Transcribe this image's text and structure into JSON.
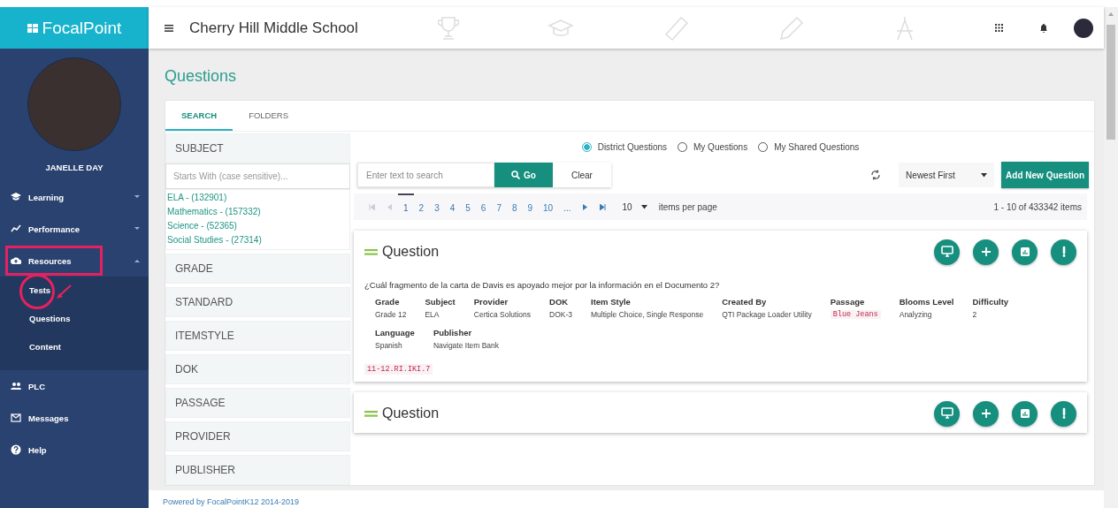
{
  "sidebar": {
    "brand": "FocalPoint",
    "user_name": "JANELLE DAY",
    "items": [
      {
        "label": "Learning",
        "expanded": false,
        "has_caret": true,
        "highlighted": false
      },
      {
        "label": "Performance",
        "expanded": false,
        "has_caret": true,
        "highlighted": false
      },
      {
        "label": "Resources",
        "expanded": true,
        "has_caret": true,
        "highlighted": true,
        "children": [
          {
            "label": "Tests",
            "highlighted": true
          },
          {
            "label": "Questions",
            "highlighted": false
          },
          {
            "label": "Content",
            "highlighted": false
          }
        ]
      },
      {
        "label": "PLC",
        "has_caret": false,
        "highlighted": false
      },
      {
        "label": "Messages",
        "has_caret": false,
        "highlighted": false
      },
      {
        "label": "Help",
        "has_caret": false,
        "highlighted": false
      }
    ]
  },
  "header": {
    "title": "Cherry Hill Middle School"
  },
  "page_title": "Questions",
  "tabs": [
    {
      "label": "SEARCH",
      "selected": true
    },
    {
      "label": "FOLDERS",
      "selected": false
    }
  ],
  "filters": [
    {
      "label": "SUBJECT",
      "expanded": true,
      "placeholder": "Starts With (case sensitive)...",
      "options": [
        "ELA - (132901)",
        "Mathematics - (157332)",
        "Science - (52365)",
        "Social Studies - (27314)"
      ]
    },
    {
      "label": "GRADE",
      "expanded": false
    },
    {
      "label": "STANDARD",
      "expanded": false
    },
    {
      "label": "ITEMSTYLE",
      "expanded": false
    },
    {
      "label": "DOK",
      "expanded": false
    },
    {
      "label": "PASSAGE",
      "expanded": false
    },
    {
      "label": "PROVIDER",
      "expanded": false
    },
    {
      "label": "PUBLISHER",
      "expanded": false
    }
  ],
  "scopes": [
    {
      "label": "District Questions",
      "selected": true
    },
    {
      "label": "My Questions",
      "selected": false
    },
    {
      "label": "My Shared Questions",
      "selected": false
    }
  ],
  "search": {
    "placeholder": "Enter text to search",
    "go_label": "Go",
    "clear_label": "Clear",
    "sort": "Newest First",
    "add_label": "Add New Question"
  },
  "pagination": {
    "pages": [
      {
        "label": "1",
        "selected": true
      },
      {
        "label": "2",
        "selected": false
      },
      {
        "label": "3",
        "selected": false
      },
      {
        "label": "4",
        "selected": false
      },
      {
        "label": "5",
        "selected": false
      },
      {
        "label": "6",
        "selected": false
      },
      {
        "label": "7",
        "selected": false
      },
      {
        "label": "8",
        "selected": false
      },
      {
        "label": "9",
        "selected": false
      },
      {
        "label": "10",
        "selected": false
      },
      {
        "label": "...",
        "selected": false
      }
    ],
    "page_size": "10",
    "page_size_label": "items per page",
    "summary": "1 - 10 of 433342 items"
  },
  "questions": [
    {
      "title": "Question",
      "text": "¿Cuál fragmento de la carta de Davis es apoyado mejor por la información en el Documento 2?",
      "field_rows": [
        [
          {
            "label": "Grade",
            "value": "Grade 12",
            "kind": "text"
          },
          {
            "label": "Subject",
            "value": "ELA",
            "kind": "text"
          },
          {
            "label": "Provider",
            "value": "Certica Solutions",
            "kind": "text"
          },
          {
            "label": "DOK",
            "value": "DOK-3",
            "kind": "text"
          },
          {
            "label": "Item Style",
            "value": "Multiple Choice, Single Response",
            "kind": "text"
          },
          {
            "label": "Created By",
            "value": "QTI Package Loader Utility",
            "kind": "text"
          },
          {
            "label": "Passage",
            "value": "Blue Jeans",
            "kind": "code"
          },
          {
            "label": "Blooms Level",
            "value": "Analyzing",
            "kind": "text"
          },
          {
            "label": "Difficulty",
            "value": "2",
            "kind": "text"
          }
        ],
        [
          {
            "label": "Language",
            "value": "Spanish",
            "kind": "text"
          },
          {
            "label": "Publisher",
            "value": "Navigate Item Bank",
            "kind": "text"
          }
        ]
      ],
      "standard": "11-12.RI.IKI.7"
    },
    {
      "title": "Question"
    }
  ],
  "footer": "Powered by FocalPointK12 2014-2019"
}
